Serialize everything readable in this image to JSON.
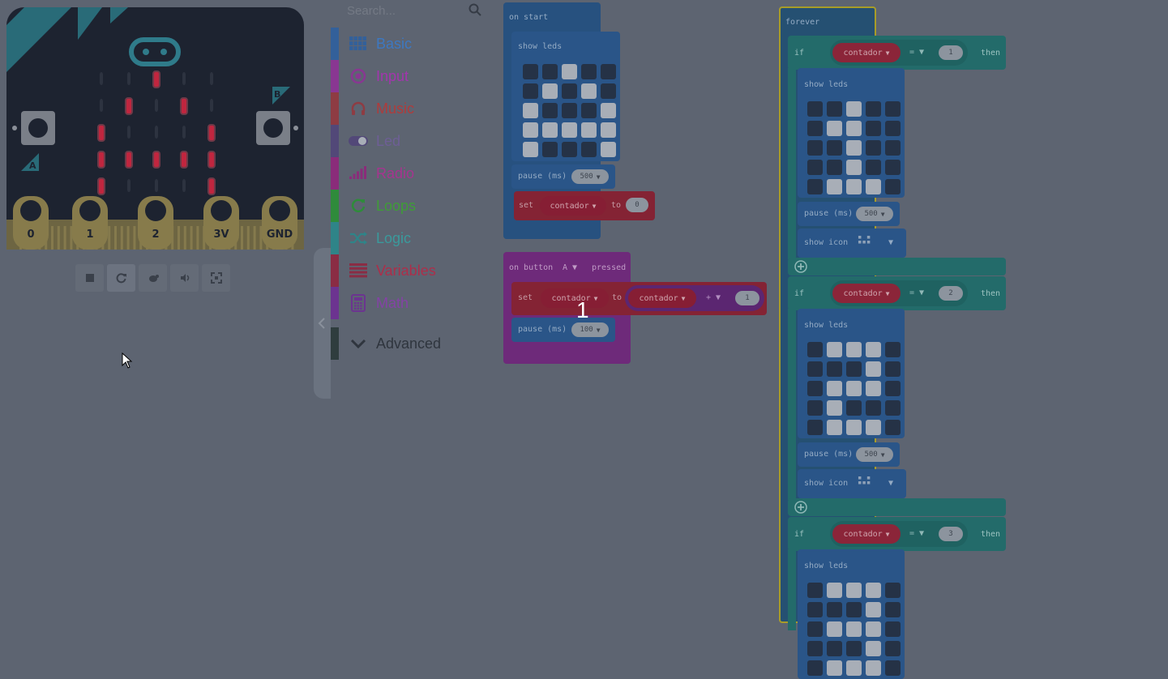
{
  "simulator": {
    "pins": [
      "0",
      "1",
      "2",
      "3V",
      "GND"
    ],
    "button_a": "A",
    "button_b": "B",
    "leds": [
      [
        0,
        0,
        1,
        0,
        0
      ],
      [
        0,
        1,
        0,
        1,
        0
      ],
      [
        1,
        0,
        0,
        0,
        1
      ],
      [
        1,
        1,
        1,
        1,
        1
      ],
      [
        1,
        0,
        0,
        0,
        1
      ]
    ],
    "led_color": "#c0263f",
    "toolbar_icons": [
      "stop-icon",
      "restart-icon",
      "slow-mo-icon",
      "mute-icon",
      "fullscreen-icon"
    ]
  },
  "toolbox": {
    "search": {
      "placeholder": "Search..."
    },
    "categories": [
      {
        "label": "Basic",
        "color": "#1e90ff",
        "icon": "grid-icon"
      },
      {
        "label": "Input",
        "color": "#d400d4",
        "icon": "target-icon"
      },
      {
        "label": "Music",
        "color": "#e63022",
        "icon": "headphones-icon"
      },
      {
        "label": "Led",
        "color": "#5c2d91",
        "icon": "toggle-icon"
      },
      {
        "label": "Radio",
        "color": "#e3008c",
        "icon": "signal-icon"
      },
      {
        "label": "Loops",
        "color": "#00aa00",
        "icon": "loop-icon"
      },
      {
        "label": "Logic",
        "color": "#00a4a6",
        "icon": "shuffle-icon"
      },
      {
        "label": "Variables",
        "color": "#dc143c",
        "icon": "list-icon"
      },
      {
        "label": "Math",
        "color": "#9400d3",
        "icon": "calculator-icon"
      },
      {
        "label": "Advanced",
        "color": "#3c3c3c",
        "icon": "chevron-down-icon"
      }
    ]
  },
  "workspace": {
    "drag_counter": "1",
    "on_start": {
      "hat": "on start",
      "show_leds": "show leds",
      "leds": [
        [
          0,
          0,
          1,
          0,
          0
        ],
        [
          0,
          1,
          0,
          1,
          0
        ],
        [
          1,
          0,
          0,
          0,
          1
        ],
        [
          1,
          1,
          1,
          1,
          1
        ],
        [
          1,
          0,
          0,
          0,
          1
        ]
      ],
      "pause_label": "pause (ms)",
      "pause_value": "500",
      "set_label": "set",
      "var": "contador",
      "to_label": "to",
      "set_value": "0"
    },
    "on_button": {
      "hat_prefix": "on button",
      "button": "A",
      "hat_suffix": "pressed",
      "set_label": "set",
      "var": "contador",
      "to_label": "to",
      "operand_var": "contador",
      "operator": "+",
      "operand_value": "1",
      "pause_label": "pause (ms)",
      "pause_value": "100"
    },
    "forever": {
      "hat": "forever",
      "if_label": "if",
      "then_label": "then",
      "var": "contador",
      "compare_op": "=",
      "show_leds": "show leds",
      "pause_label": "pause (ms)",
      "pause_value": "500",
      "show_icon": "show icon",
      "branches": [
        {
          "value": "1",
          "leds": [
            [
              0,
              0,
              1,
              0,
              0
            ],
            [
              0,
              1,
              1,
              0,
              0
            ],
            [
              0,
              0,
              1,
              0,
              0
            ],
            [
              0,
              0,
              1,
              0,
              0
            ],
            [
              0,
              1,
              1,
              1,
              0
            ]
          ]
        },
        {
          "value": "2",
          "leds": [
            [
              0,
              1,
              1,
              1,
              0
            ],
            [
              0,
              0,
              0,
              1,
              0
            ],
            [
              0,
              1,
              1,
              1,
              0
            ],
            [
              0,
              1,
              0,
              0,
              0
            ],
            [
              0,
              1,
              1,
              1,
              0
            ]
          ]
        },
        {
          "value": "3",
          "leds": [
            [
              0,
              1,
              1,
              1,
              0
            ],
            [
              0,
              0,
              0,
              1,
              0
            ],
            [
              0,
              1,
              1,
              1,
              0
            ],
            [
              0,
              0,
              0,
              1,
              0
            ],
            [
              0,
              1,
              1,
              1,
              0
            ]
          ]
        }
      ]
    }
  }
}
